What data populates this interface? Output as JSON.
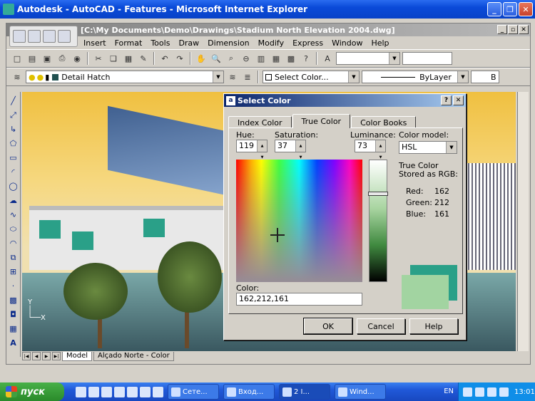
{
  "browser": {
    "title": "Autodesk - AutoCAD - Features - Microsoft Internet Explorer"
  },
  "acad": {
    "title": "[C:\\My Documents\\Demo\\Drawings\\Stadium North Elevation 2004.dwg]",
    "menu": [
      "Insert",
      "Format",
      "Tools",
      "Draw",
      "Dimension",
      "Modify",
      "Express",
      "Window",
      "Help"
    ],
    "layer": "Detail Hatch",
    "color_combo": "Select Color...",
    "linetype": "ByLayer",
    "lineweight": "B",
    "layout_tabs": [
      "Model",
      "Alçado Norte - Color"
    ]
  },
  "dialog": {
    "title": "Select Color",
    "tabs": [
      "Index Color",
      "True Color",
      "Color Books"
    ],
    "hue_label": "Hue:",
    "hue": "119",
    "sat_label": "Saturation:",
    "sat": "37",
    "lum_label": "Luminance:",
    "lum": "73",
    "model_label": "Color model:",
    "model": "HSL",
    "stored_label": "True Color Stored as RGB:",
    "red_label": "Red:",
    "red": "162",
    "green_label": "Green:",
    "green": "212",
    "blue_label": "Blue:",
    "blue": "161",
    "color_label": "Color:",
    "color_value": "162,212,161",
    "ok": "OK",
    "cancel": "Cancel",
    "help": "Help",
    "new_color": "#a2d4a1",
    "old_color": "#2aa088"
  },
  "taskbar": {
    "start": "пуск",
    "tasks": [
      "Сете...",
      "Вход...",
      "2 I...",
      "Wind..."
    ],
    "lang": "EN",
    "clock": "13:01"
  }
}
